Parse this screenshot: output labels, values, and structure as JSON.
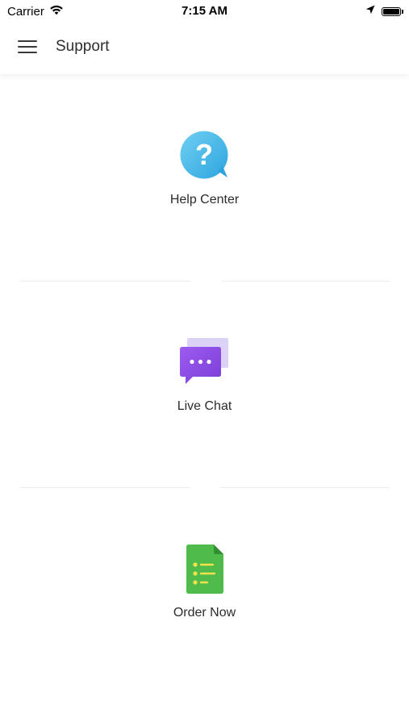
{
  "status_bar": {
    "carrier": "Carrier",
    "time": "7:15 AM"
  },
  "icons": {
    "menu": "hamburger-menu-icon",
    "wifi": "wifi-icon",
    "location": "location-arrow-icon",
    "battery": "battery-icon",
    "help": "question-bubble-icon",
    "chat": "chat-bubble-icon",
    "order": "document-list-icon"
  },
  "header": {
    "title": "Support"
  },
  "options": [
    {
      "label": "Help Center"
    },
    {
      "label": "Live Chat"
    },
    {
      "label": "Order Now"
    }
  ],
  "colors": {
    "help_icon": "#3fb6e5",
    "chat_icon": "#8b4fe0",
    "chat_icon_back": "#d9cdf6",
    "order_icon": "#4cb94a",
    "order_icon_lines": "#f4e14b"
  }
}
